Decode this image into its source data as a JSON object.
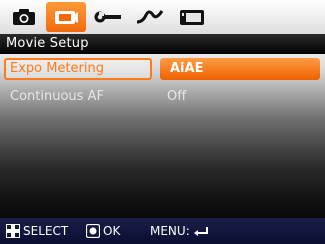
{
  "tabs": [
    {
      "name": "camera",
      "icon": "camera-icon",
      "selected": false
    },
    {
      "name": "movie",
      "icon": "movie-camera-icon",
      "selected": true
    },
    {
      "name": "setup",
      "icon": "wrench-icon",
      "selected": false
    },
    {
      "name": "playback",
      "icon": "curve-icon",
      "selected": false
    },
    {
      "name": "display",
      "icon": "screen-icon",
      "selected": false
    }
  ],
  "header": {
    "title": "Movie Setup"
  },
  "menu": [
    {
      "label": "Expo Metering",
      "value": "AiAE",
      "selected": true
    },
    {
      "label": "Continuous AF",
      "value": "Off",
      "selected": false
    }
  ],
  "footer": {
    "select_label": "SELECT",
    "ok_label": "OK",
    "menu_label": "MENU:"
  },
  "colors": {
    "accent": "#ff7a1a",
    "footer_bg": "#0f1338",
    "header_bg": "#000000"
  }
}
